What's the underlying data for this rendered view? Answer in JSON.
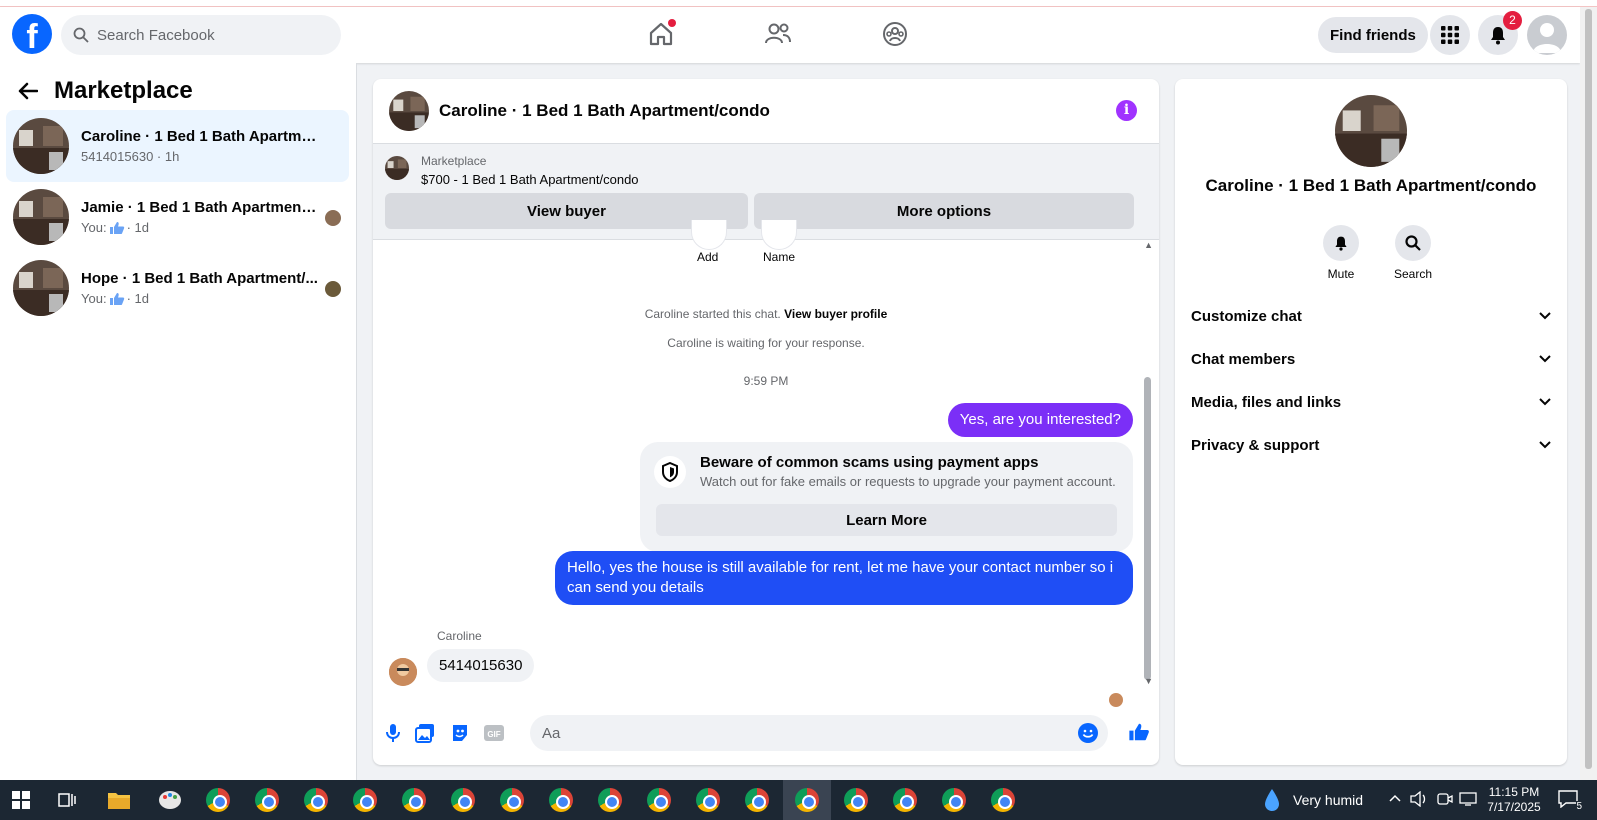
{
  "topbar": {
    "logo_letter": "f",
    "search_placeholder": "Search Facebook",
    "find_friends": "Find friends",
    "notifications_count": "2"
  },
  "sidebar": {
    "title": "Marketplace",
    "conversations": [
      {
        "title": "Caroline · 1 Bed 1 Bath Apartment/...",
        "sub": "5414015630 · 1h",
        "active": true
      },
      {
        "title": "Jamie · 1 Bed 1 Bath Apartment/...",
        "sub_prefix": "You:",
        "sub_time": "· 1d"
      },
      {
        "title": "Hope · 1 Bed 1 Bath Apartment/...",
        "sub_prefix": "You:",
        "sub_time": "· 1d"
      }
    ]
  },
  "chat": {
    "header_title": "Caroline · 1 Bed 1 Bath Apartment/condo",
    "info_glyph": "i",
    "marketplace_label": "Marketplace",
    "listing": "$700 - 1 Bed 1 Bath Apartment/condo",
    "view_buyer": "View buyer",
    "more_options": "More options",
    "ghost_add": "Add",
    "ghost_name": "Name",
    "started_text": "Caroline started this chat.",
    "view_buyer_profile": "View buyer profile",
    "waiting_text": "Caroline is waiting for your response.",
    "time": "9:59 PM",
    "msg_out_1": "Yes, are you interested?",
    "scam_title": "Beware of common scams using payment apps",
    "scam_desc": "Watch out for fake emails or requests to upgrade your payment account.",
    "learn_more": "Learn More",
    "msg_out_2": "Hello, yes the house is still available for rent, let me have your contact number so i can send you details",
    "sender_name": "Caroline",
    "msg_in_1": "5414015630",
    "composer_placeholder": "Aa"
  },
  "right_panel": {
    "name": "Caroline · 1 Bed 1 Bath Apartment/condo",
    "mute": "Mute",
    "search": "Search",
    "sections": [
      "Customize chat",
      "Chat members",
      "Media, files and links",
      "Privacy & support"
    ]
  },
  "taskbar": {
    "weather": "Very humid",
    "time": "11:15 PM",
    "date": "7/17/2025",
    "notif_count": "5"
  },
  "colors": {
    "brand_blue": "#0866ff",
    "bubble_purple": "#7b2ff7",
    "bubble_blue": "#1f4ef5"
  }
}
